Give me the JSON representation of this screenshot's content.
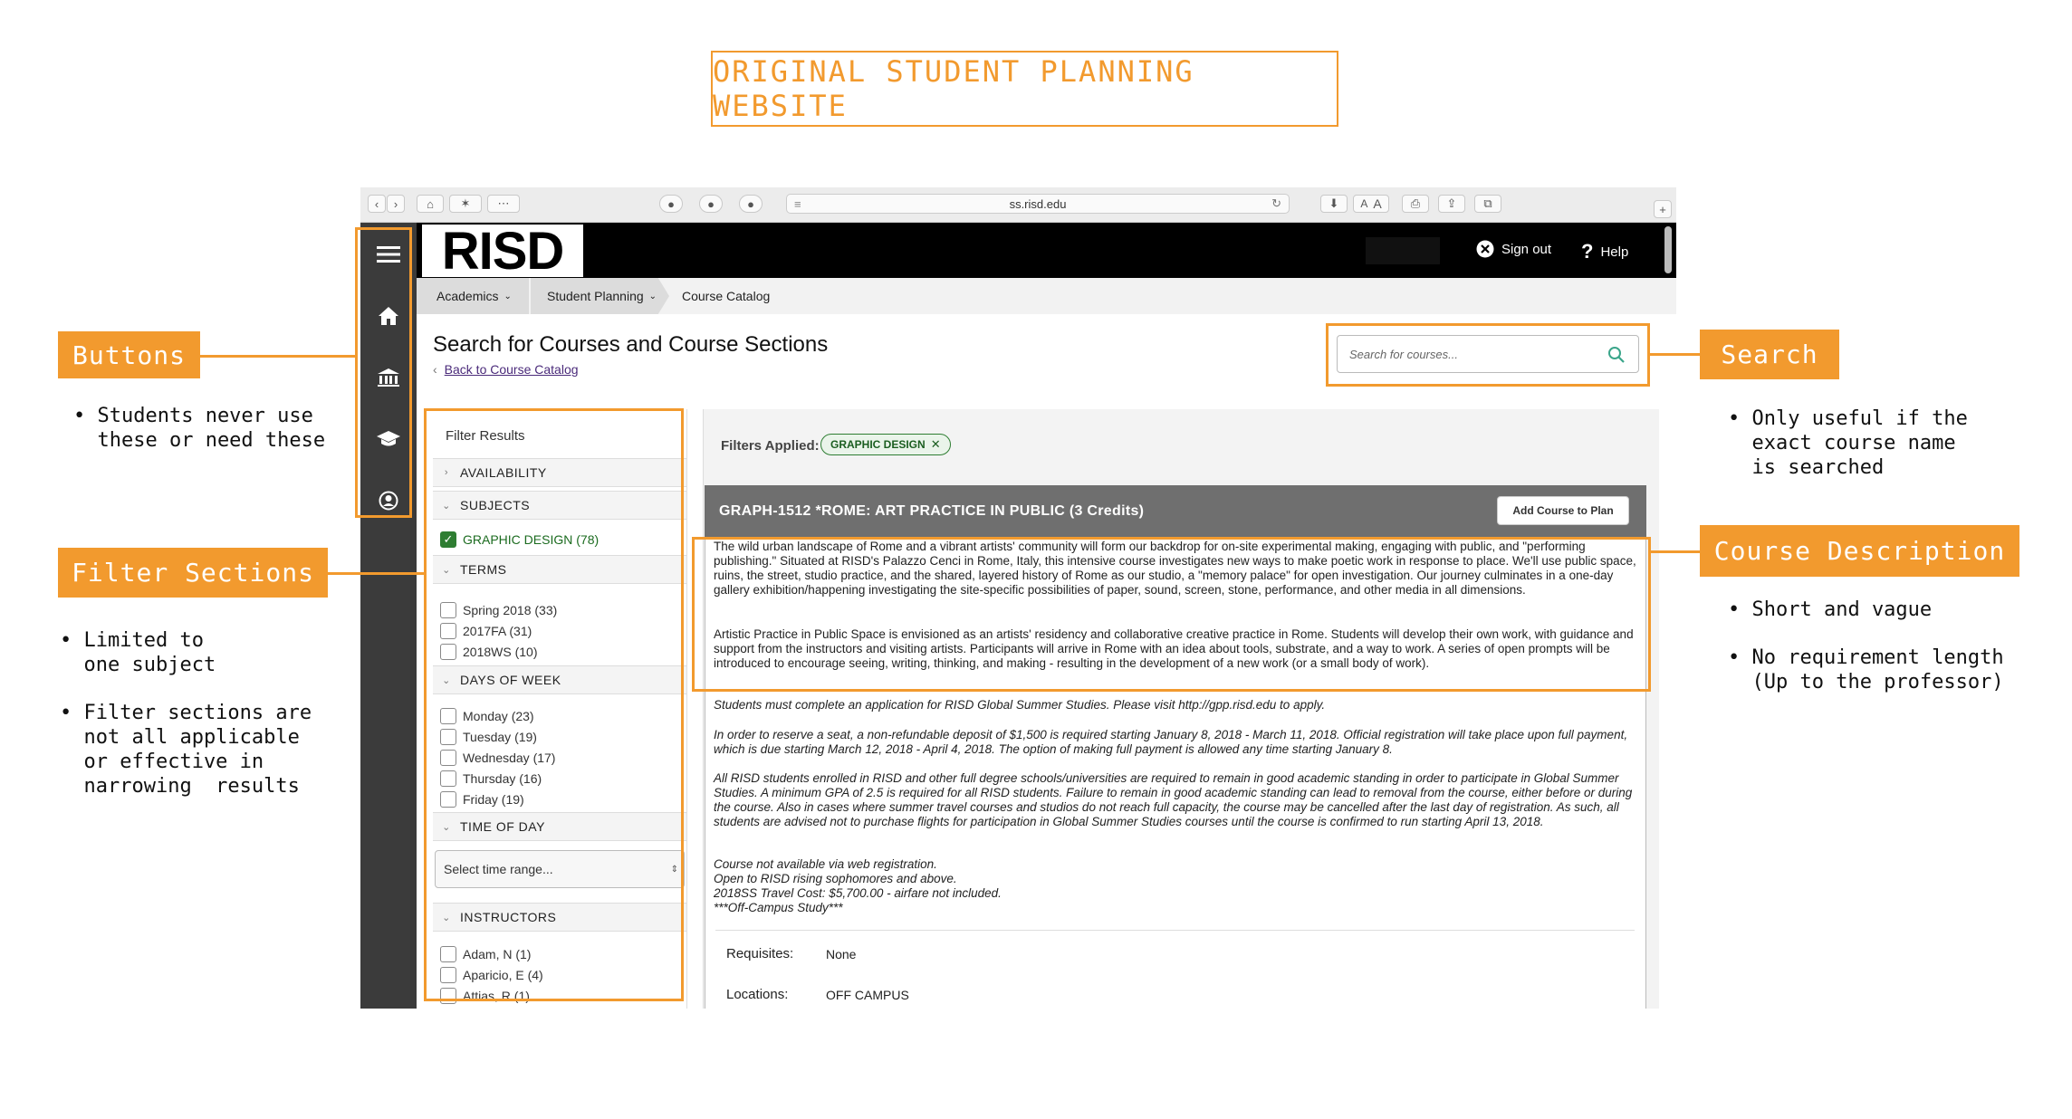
{
  "title": "ORIGINAL STUDENT PLANNING WEBSITE",
  "annotations": {
    "buttons": {
      "label": "Buttons",
      "notes": [
        "• Students never use\n  these or need these"
      ]
    },
    "filter_sections": {
      "label": "Filter Sections",
      "notes": [
        "• Limited to\n  one subject",
        "• Filter sections are\n  not all applicable\n  or effective in\n  narrowing  results"
      ]
    },
    "search": {
      "label": "Search",
      "notes": [
        "• Only useful if the\n  exact course name\n  is searched"
      ]
    },
    "course_description": {
      "label": "Course Description",
      "notes": [
        "• Short and vague",
        "• No requirement length\n  (Up to the professor)"
      ]
    }
  },
  "browser": {
    "url": "ss.risd.edu",
    "reader_a_small": "A",
    "reader_a_large": "A"
  },
  "header": {
    "logo": "RISD",
    "sign_out": "Sign out",
    "help": "Help"
  },
  "breadcrumbs": [
    "Academics",
    "Student Planning",
    "Course Catalog"
  ],
  "page": {
    "title": "Search for Courses and Course Sections",
    "back_link": "Back to Course Catalog",
    "search_placeholder": "Search for courses..."
  },
  "filters": {
    "heading": "Filter Results",
    "availability": "AVAILABILITY",
    "subjects": "SUBJECTS",
    "subject_options": [
      {
        "label": "GRAPHIC DESIGN (78)",
        "checked": true
      }
    ],
    "terms": "TERMS",
    "term_options": [
      "Spring 2018 (33)",
      "2017FA (31)",
      "2018WS (10)"
    ],
    "days": "DAYS OF WEEK",
    "day_options": [
      "Monday (23)",
      "Tuesday (19)",
      "Wednesday (17)",
      "Thursday (16)",
      "Friday (19)"
    ],
    "time": "TIME OF DAY",
    "time_select": "Select time range...",
    "instructors": "INSTRUCTORS",
    "instructor_options": [
      "Adam, N (1)",
      "Aparicio, E (4)",
      "Attias, R (1)"
    ]
  },
  "results": {
    "filters_applied_label": "Filters Applied:",
    "chip": "GRAPHIC DESIGN",
    "course_title": "GRAPH-1512 *ROME: ART PRACTICE IN PUBLIC (3 Credits)",
    "add_button": "Add Course to Plan",
    "desc1": "The wild urban landscape of Rome and a vibrant artists' community will form our backdrop for on-site experimental making, engaging with public, and \"performing publishing.\" Situated at RISD's Palazzo Cenci in Rome, Italy, this intensive course investigates new ways to make poetic work in response to place. We'll use public space, ruins, the street, studio practice, and the shared, layered history of Rome as our studio, a \"memory palace\" for open investigation. Our journey culminates in a one-day gallery exhibition/happening investigating the site-specific possibilities of paper, sound, screen, stone, performance, and other media in all dimensions.",
    "desc2": "Artistic Practice in Public Space is envisioned as an artists' residency and collaborative creative practice in Rome. Students will develop their own work, with guidance and support from the instructors and visiting artists. Participants will arrive in Rome with an idea about tools, substrate, and a way to work. A series of open prompts will be introduced to encourage seeing, writing, thinking, and making - resulting in the development of a new work (or a small body of work).",
    "note1": "Students must complete an application for RISD Global Summer Studies. Please visit http://gpp.risd.edu to apply.",
    "note2": "In order to reserve a seat, a non-refundable deposit of $1,500 is required starting January 8, 2018 - March 11, 2018. Official registration will take place upon full payment, which is due starting March 12, 2018 - April 4, 2018. The option of making full payment is allowed any time starting January 8.",
    "note3": "All RISD students enrolled in RISD and other full degree schools/universities are required to remain in good academic standing in order to participate in Global Summer Studies. A minimum GPA of 2.5 is required for all RISD students. Failure to remain in good academic standing can lead to removal from the course, either before or during the course. Also in cases where summer travel courses and studios do not reach full capacity, the course may be cancelled after the last day of registration. As such, all students are advised not to purchase flights for participation in Global Summer Studies courses until the course is confirmed to run starting April 13, 2018.",
    "note4a": "Course not available via web registration.",
    "note4b": "Open to RISD rising sophomores and above.",
    "note4c": "2018SS Travel Cost: $5,700.00 - airfare not included.",
    "note4d": "***Off-Campus Study***",
    "requisites_label": "Requisites:",
    "requisites_value": "None",
    "locations_label": "Locations:",
    "locations_value": "OFF CAMPUS"
  }
}
